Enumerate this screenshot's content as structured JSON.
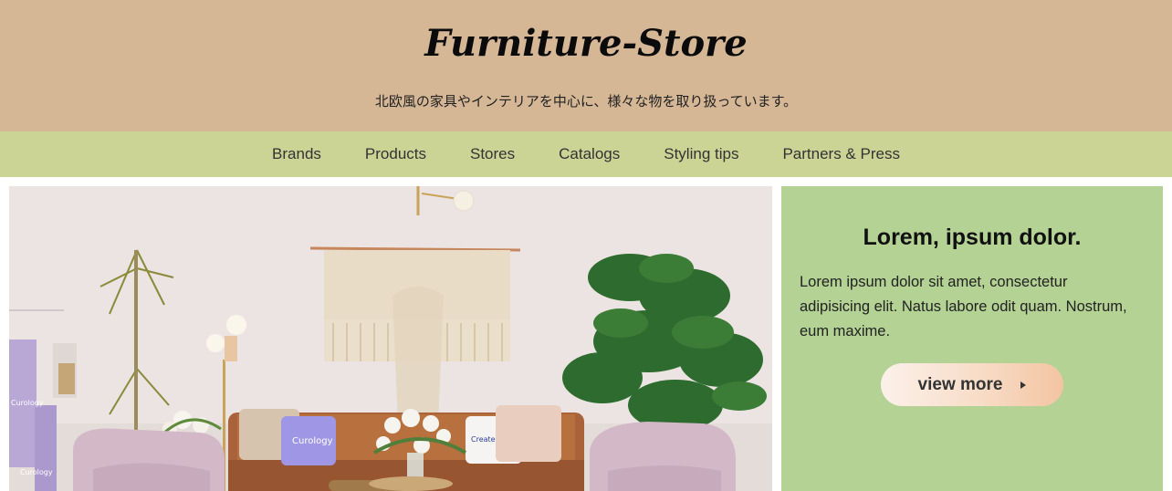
{
  "header": {
    "site_title": "Furniture-Store",
    "tagline": "北欧風の家具やインテリアを中心に、様々な物を取り扱っています。"
  },
  "nav": {
    "items": [
      {
        "label": "Brands"
      },
      {
        "label": "Products"
      },
      {
        "label": "Stores"
      },
      {
        "label": "Catalogs"
      },
      {
        "label": "Styling tips"
      },
      {
        "label": "Partners & Press"
      }
    ]
  },
  "hero": {
    "pillow_text_1": "Curology",
    "pillow_text_2": "Createyoskin",
    "towel_text": "Curology"
  },
  "card": {
    "heading": "Lorem, ipsum dolor.",
    "body": "Lorem ipsum dolor sit amet, consectetur adipisicing elit. Natus labore odit quam. Nostrum, eum maxime.",
    "button_label": "view more",
    "button_icon": "arrow-right-icon"
  },
  "colors": {
    "header_bg": "#d5b796",
    "nav_bg": "#cbd495",
    "card_bg": "#b3d294"
  }
}
